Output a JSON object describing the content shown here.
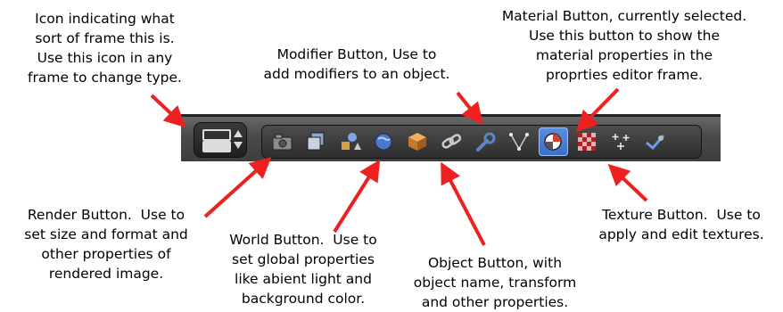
{
  "annotations": {
    "frame_type": "Icon indicating what\nsort of frame this is.\nUse this icon in any\nframe to change type.",
    "modifier": "Modifier Button, Use to\nadd modifiers to an object.",
    "material": "Material Button, currently selected.\nUse this button to show the\nmaterial properties in the\nproprties editor frame.",
    "render": "Render Button.  Use to\nset size and format and\nother properties of\nrendered image.",
    "world": "World Button.  Use to\nset global properties\nlike abient light and\nbackground color.",
    "object": "Object Button, with\nobject name, transform\nand other properties.",
    "texture": "Texture Button.  Use to\napply and edit textures."
  },
  "toolbar": {
    "editor_type_icon": "editor-type-icon",
    "tabs": [
      {
        "icon": "render-camera-icon"
      },
      {
        "icon": "render-layers-icon"
      },
      {
        "icon": "scene-icon"
      },
      {
        "icon": "world-icon"
      },
      {
        "icon": "object-cube-icon"
      },
      {
        "icon": "constraints-chain-icon"
      },
      {
        "icon": "modifier-wrench-icon"
      },
      {
        "icon": "object-data-mesh-icon"
      },
      {
        "icon": "material-icon",
        "selected": true
      },
      {
        "icon": "texture-checker-icon"
      },
      {
        "icon": "particles-icon"
      },
      {
        "icon": "physics-icon"
      }
    ]
  },
  "colors": {
    "arrow": "#ee2020",
    "selected_tab": "#4a80d8",
    "header_bg": "#4a4a4a"
  }
}
